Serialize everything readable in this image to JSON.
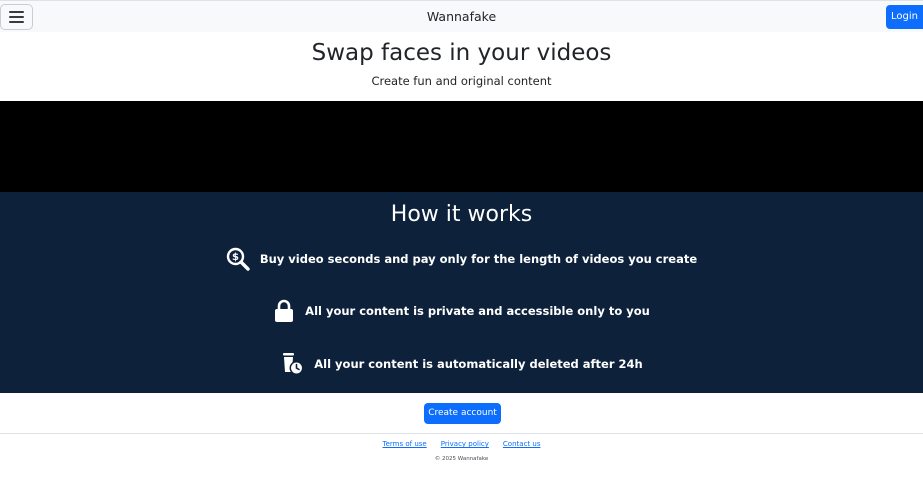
{
  "navbar": {
    "brand": "Wannafake",
    "login_label": "Login",
    "menu_icon": "hamburger-icon"
  },
  "hero": {
    "title": "Swap faces in your videos",
    "subtitle": "Create fun and original content"
  },
  "how_it_works": {
    "title": "How it works",
    "features": [
      {
        "icon": "dollar-search-icon",
        "text": "Buy video seconds and pay only for the length of videos you create"
      },
      {
        "icon": "lock-icon",
        "text": "All your content is private and accessible only to you"
      },
      {
        "icon": "trash-clock-icon",
        "text": "All your content is automatically deleted after 24h"
      }
    ]
  },
  "cta": {
    "label": "Create account"
  },
  "footer": {
    "links": [
      "Terms of use",
      "Privacy policy",
      "Contact us"
    ],
    "copyright": "© 2025 Wannafake"
  },
  "colors": {
    "primary": "#0d6efd",
    "navbar_bg": "#f8f9fa",
    "section_bg": "#0d213b",
    "video_bg": "#000000"
  }
}
